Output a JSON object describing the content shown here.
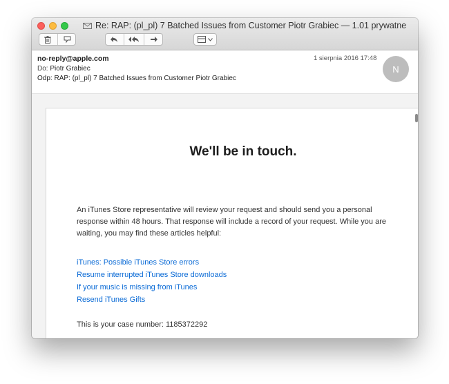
{
  "window": {
    "title": "Re: RAP: (pl_pl) 7 Batched Issues from Customer Piotr Grabiec — 1.01 prywatne"
  },
  "toolbar": {
    "icons": [
      "trash-icon",
      "junk-icon",
      "reply-icon",
      "reply-all-icon",
      "forward-icon",
      "archive-move-icon"
    ]
  },
  "message": {
    "from": "no-reply@apple.com",
    "to_label": "Do:",
    "to": "Piotr Grabiec",
    "subject_label": "Odp:",
    "subject": "RAP: (pl_pl) 7 Batched Issues from Customer Piotr Grabiec",
    "date": "1 sierpnia 2016 17:48",
    "avatar_initial": "N"
  },
  "body": {
    "headline": "We'll be in touch.",
    "paragraph": "An iTunes Store representative will review your request and should send you a personal response within 48 hours. That response will include a record of your request. While you are waiting, you may find these articles helpful:",
    "links": [
      "iTunes: Possible iTunes Store errors",
      "Resume interrupted iTunes Store downloads",
      "If your music is missing from iTunes",
      "Resend iTunes Gifts"
    ],
    "case_text": "This is your case number: 1185372292"
  },
  "colors": {
    "link": "#0b6bd6",
    "red": "#fc605c",
    "yellow": "#fdbc40",
    "green": "#34c84a"
  }
}
